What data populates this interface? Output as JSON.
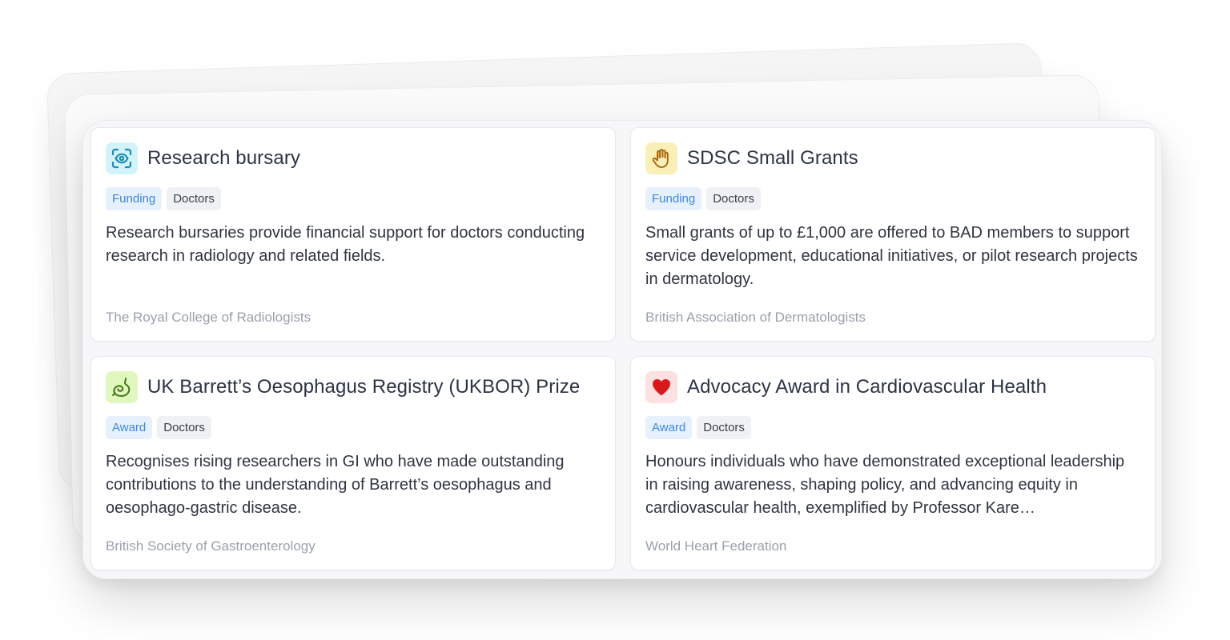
{
  "cards": [
    {
      "title": "Research bursary",
      "icon": "eye-scan-icon",
      "icon_bg": "#d3f3fa",
      "tags": [
        "Funding",
        "Doctors"
      ],
      "description": "Research bursaries provide financial support for doctors conducting research in radiology and related fields.",
      "organization": "The Royal College of Radiologists"
    },
    {
      "title": "SDSC Small Grants",
      "icon": "hand-icon",
      "icon_bg": "#fbefb8",
      "tags": [
        "Funding",
        "Doctors"
      ],
      "description": "Small grants of up to £1,000 are offered to BAD members to support service development, educational initiatives, or pilot research projects in dermatology.",
      "organization": "British Association of Dermatologists"
    },
    {
      "title": "UK Barrett’s Oesophagus Registry (UKBOR) Prize",
      "icon": "stomach-icon",
      "icon_bg": "#e2f6bf",
      "tags": [
        "Award",
        "Doctors"
      ],
      "description": "Recognises rising researchers in GI who have made outstanding contributions to the understanding of Barrett’s oesophagus and oesophago-gastric disease.",
      "organization": "British Society of Gastroenterology"
    },
    {
      "title": "Advocacy Award in Cardiovascular Health",
      "icon": "heart-icon",
      "icon_bg": "#fde0e0",
      "tags": [
        "Award",
        "Doctors"
      ],
      "description": "Honours individuals who have demonstrated exceptional leadership in raising awareness, shaping policy, and advancing equity in cardiovascular health, exemplified by Professor Kare…",
      "organization": "World Heart Federation"
    }
  ],
  "colors": {
    "tag_kind_bg": "#e7f1fd",
    "tag_kind_text": "#3d86df",
    "tag_audience_bg": "#f0f1f4",
    "title_text": "#2b3445",
    "org_text": "#9aa1ad"
  }
}
